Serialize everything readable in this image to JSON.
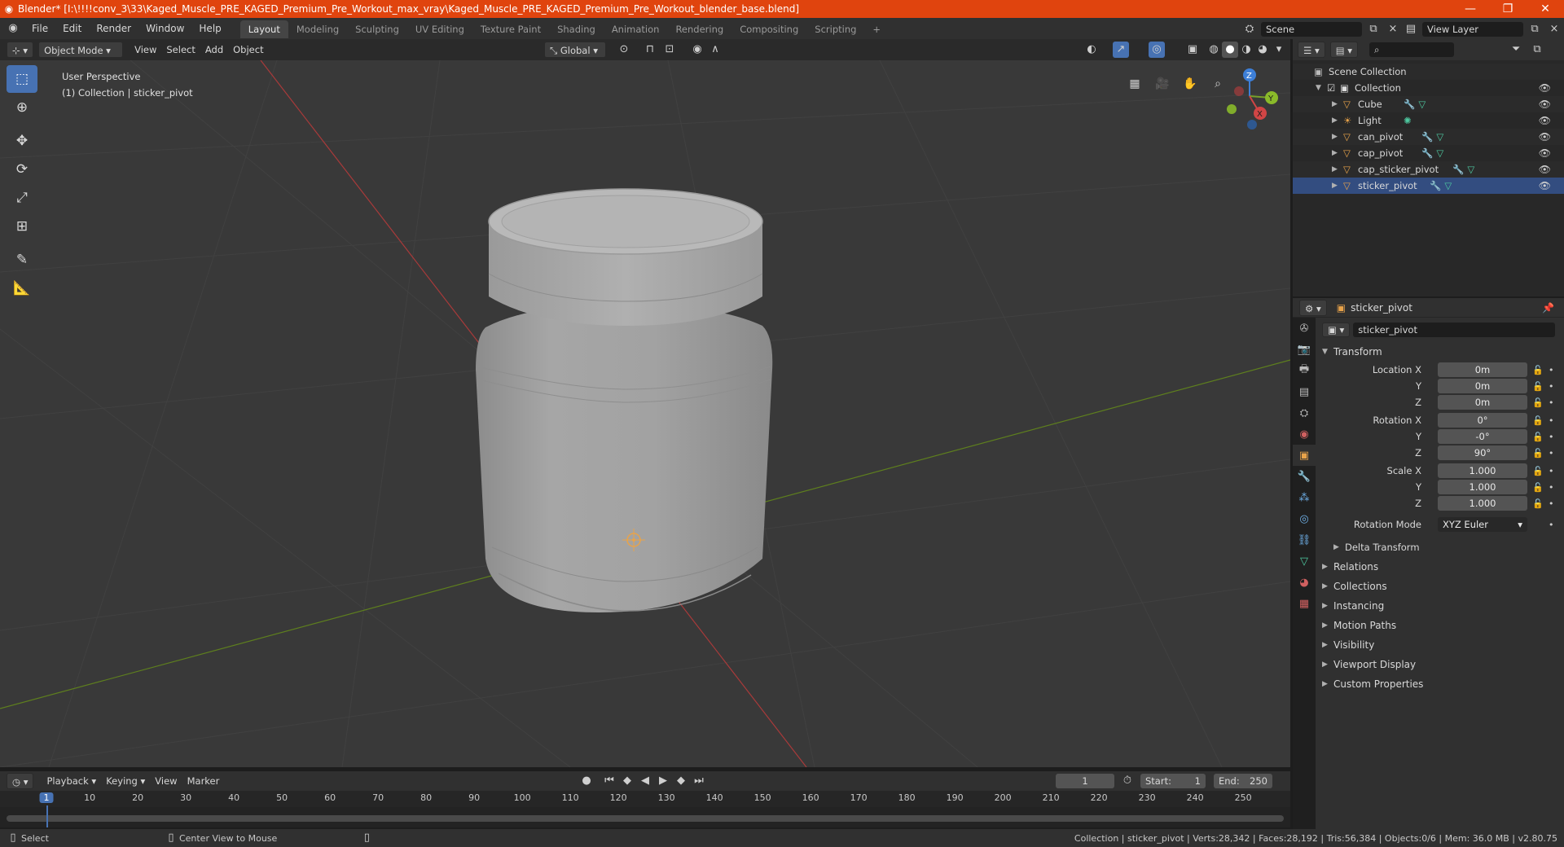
{
  "titlebar": {
    "title": "Blender* [I:\\!!!!conv_3\\33\\Kaged_Muscle_PRE_KAGED_Premium_Pre_Workout_max_vray\\Kaged_Muscle_PRE_KAGED_Premium_Pre_Workout_blender_base.blend]",
    "minimize": "—",
    "restore": "❐",
    "close": "✕"
  },
  "menus": [
    "File",
    "Edit",
    "Render",
    "Window",
    "Help"
  ],
  "workspaces": [
    "Layout",
    "Modeling",
    "Sculpting",
    "UV Editing",
    "Texture Paint",
    "Shading",
    "Animation",
    "Rendering",
    "Compositing",
    "Scripting"
  ],
  "add_workspace": "+",
  "scene": {
    "label": "Scene",
    "view_layer": "View Layer"
  },
  "viewport_header": {
    "mode": "Object Mode",
    "menus": [
      "View",
      "Select",
      "Add",
      "Object"
    ],
    "orientation": "Global"
  },
  "viewport": {
    "perspective": "User Perspective",
    "collection_info": "(1) Collection | sticker_pivot",
    "gizmo": {
      "x": "X",
      "y": "Y",
      "z": "Z"
    }
  },
  "outliner": {
    "root": "Scene Collection",
    "collection": "Collection",
    "items": [
      {
        "name": "Cube",
        "type": "mesh"
      },
      {
        "name": "Light",
        "type": "light"
      },
      {
        "name": "can_pivot",
        "type": "mesh"
      },
      {
        "name": "cap_pivot",
        "type": "mesh"
      },
      {
        "name": "cap_sticker_pivot",
        "type": "mesh"
      },
      {
        "name": "sticker_pivot",
        "type": "mesh"
      }
    ]
  },
  "properties": {
    "object_name": "sticker_pivot",
    "datablock_name": "sticker_pivot",
    "transform_title": "Transform",
    "location_label": "Location X",
    "rotation_label": "Rotation X",
    "scale_label": "Scale X",
    "y_label": "Y",
    "z_label": "Z",
    "location": [
      "0m",
      "0m",
      "0m"
    ],
    "rotation": [
      "0°",
      "-0°",
      "90°"
    ],
    "scale": [
      "1.000",
      "1.000",
      "1.000"
    ],
    "rotation_mode_label": "Rotation Mode",
    "rotation_mode": "XYZ Euler",
    "delta_transform": "Delta Transform",
    "sections": [
      "Relations",
      "Collections",
      "Instancing",
      "Motion Paths",
      "Visibility",
      "Viewport Display",
      "Custom Properties"
    ]
  },
  "timeline": {
    "menus": [
      "Playback",
      "Keying",
      "View",
      "Marker"
    ],
    "current_frame": "1",
    "start_label": "Start:",
    "start": "1",
    "end_label": "End:",
    "end": "250",
    "ruler": [
      "1",
      "10",
      "20",
      "30",
      "40",
      "50",
      "60",
      "70",
      "80",
      "90",
      "100",
      "110",
      "120",
      "130",
      "140",
      "150",
      "160",
      "170",
      "180",
      "190",
      "200",
      "210",
      "220",
      "230",
      "240",
      "250"
    ]
  },
  "statusbar": {
    "select": "Select",
    "center_view": "Center View to Mouse",
    "stats": "Collection | sticker_pivot | Verts:28,342 | Faces:28,192 | Tris:56,384 | Objects:0/6 | Mem: 36.0 MB | v2.80.75"
  },
  "colors": {
    "titlebar": "#e0440e",
    "active_tool": "#4772b3",
    "x_axis": "#c2403e",
    "y_axis": "#6e9a1e",
    "object_orange": "#e8a34a"
  }
}
